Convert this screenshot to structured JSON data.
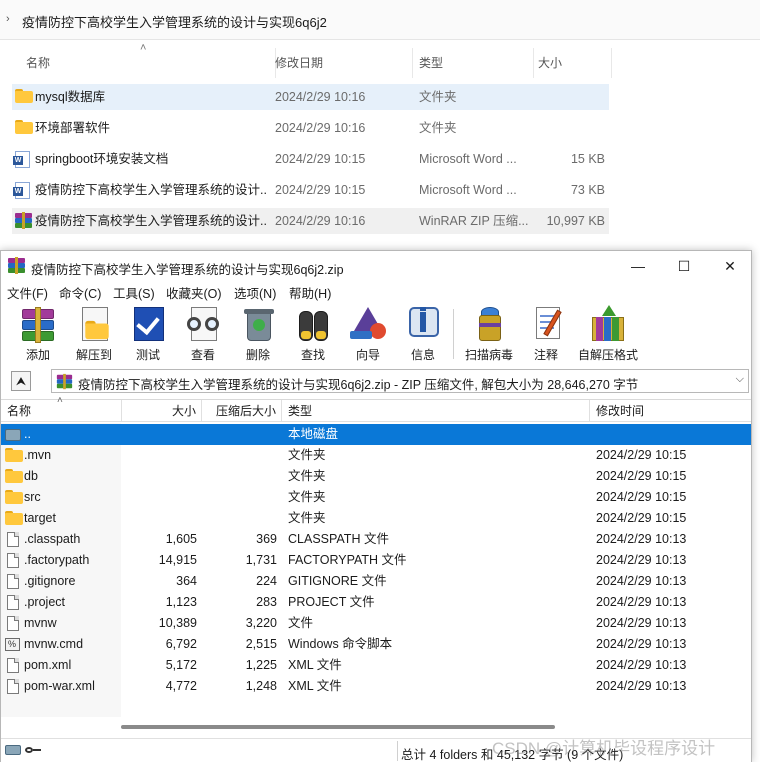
{
  "explorer": {
    "path": "疫情防控下高校学生入学管理系统的设计与实现6q6j2",
    "columns": {
      "name": "名称",
      "modified": "修改日期",
      "type": "类型",
      "size": "大小"
    },
    "rows": [
      {
        "icon": "folder-icon",
        "name": "mysql数据库",
        "modified": "2024/2/29 10:16",
        "type": "文件夹",
        "size": ""
      },
      {
        "icon": "folder-icon",
        "name": "环境部署软件",
        "modified": "2024/2/29 10:16",
        "type": "文件夹",
        "size": ""
      },
      {
        "icon": "word-doc-icon",
        "name": "springboot环境安装文档",
        "modified": "2024/2/29 10:15",
        "type": "Microsoft Word ...",
        "size": "15 KB"
      },
      {
        "icon": "word-doc-icon",
        "name": "疫情防控下高校学生入学管理系统的设计...",
        "modified": "2024/2/29 10:15",
        "type": "Microsoft Word ...",
        "size": "73 KB"
      },
      {
        "icon": "winrar-archive-icon",
        "name": "疫情防控下高校学生入学管理系统的设计...",
        "modified": "2024/2/29 10:16",
        "type": "WinRAR ZIP 压缩...",
        "size": "10,997 KB"
      }
    ]
  },
  "winrar": {
    "title": "疫情防控下高校学生入学管理系统的设计与实现6q6j2.zip",
    "window_buttons": {
      "minimize": "—",
      "maximize": "☐",
      "close": "✕"
    },
    "menu": [
      "文件(F)",
      "命令(C)",
      "工具(S)",
      "收藏夹(O)",
      "选项(N)",
      "帮助(H)"
    ],
    "toolbar": [
      "添加",
      "解压到",
      "测试",
      "查看",
      "删除",
      "查找",
      "向导",
      "信息",
      "扫描病毒",
      "注释",
      "自解压格式"
    ],
    "up_button": "⮝",
    "path_text": "疫情防控下高校学生入学管理系统的设计与实现6q6j2.zip - ZIP 压缩文件, 解包大小为 28,646,270 字节",
    "columns": {
      "name": "名称",
      "size": "大小",
      "packed": "压缩后大小",
      "type": "类型",
      "modified": "修改时间"
    },
    "rows": [
      {
        "icon": "drive-icon",
        "name": "..",
        "size": "",
        "packed": "",
        "type": "本地磁盘",
        "modified": ""
      },
      {
        "icon": "folder-icon",
        "name": ".mvn",
        "size": "",
        "packed": "",
        "type": "文件夹",
        "modified": "2024/2/29 10:15"
      },
      {
        "icon": "folder-icon",
        "name": "db",
        "size": "",
        "packed": "",
        "type": "文件夹",
        "modified": "2024/2/29 10:15"
      },
      {
        "icon": "folder-icon",
        "name": "src",
        "size": "",
        "packed": "",
        "type": "文件夹",
        "modified": "2024/2/29 10:15"
      },
      {
        "icon": "folder-icon",
        "name": "target",
        "size": "",
        "packed": "",
        "type": "文件夹",
        "modified": "2024/2/29 10:15"
      },
      {
        "icon": "file-icon",
        "name": ".classpath",
        "size": "1,605",
        "packed": "369",
        "type": "CLASSPATH 文件",
        "modified": "2024/2/29 10:13"
      },
      {
        "icon": "file-icon",
        "name": ".factorypath",
        "size": "14,915",
        "packed": "1,731",
        "type": "FACTORYPATH 文件",
        "modified": "2024/2/29 10:13"
      },
      {
        "icon": "file-icon",
        "name": ".gitignore",
        "size": "364",
        "packed": "224",
        "type": "GITIGNORE 文件",
        "modified": "2024/2/29 10:13"
      },
      {
        "icon": "file-icon",
        "name": ".project",
        "size": "1,123",
        "packed": "283",
        "type": "PROJECT 文件",
        "modified": "2024/2/29 10:13"
      },
      {
        "icon": "file-icon",
        "name": "mvnw",
        "size": "10,389",
        "packed": "3,220",
        "type": "文件",
        "modified": "2024/2/29 10:13"
      },
      {
        "icon": "cmd-script-icon",
        "name": "mvnw.cmd",
        "size": "6,792",
        "packed": "2,515",
        "type": "Windows 命令脚本",
        "modified": "2024/2/29 10:13"
      },
      {
        "icon": "file-icon",
        "name": "pom.xml",
        "size": "5,172",
        "packed": "1,225",
        "type": "XML 文件",
        "modified": "2024/2/29 10:13"
      },
      {
        "icon": "file-icon",
        "name": "pom-war.xml",
        "size": "4,772",
        "packed": "1,248",
        "type": "XML 文件",
        "modified": "2024/2/29 10:13"
      }
    ],
    "status": "总计 4 folders 和 45,132 字节 (9 个文件)"
  },
  "watermark": "CSDN @计算机毕设程序设计",
  "colors": {
    "selection": "#0a78d7",
    "explorer_selection": "#e6f0fa",
    "folder": "#ffc83d"
  }
}
